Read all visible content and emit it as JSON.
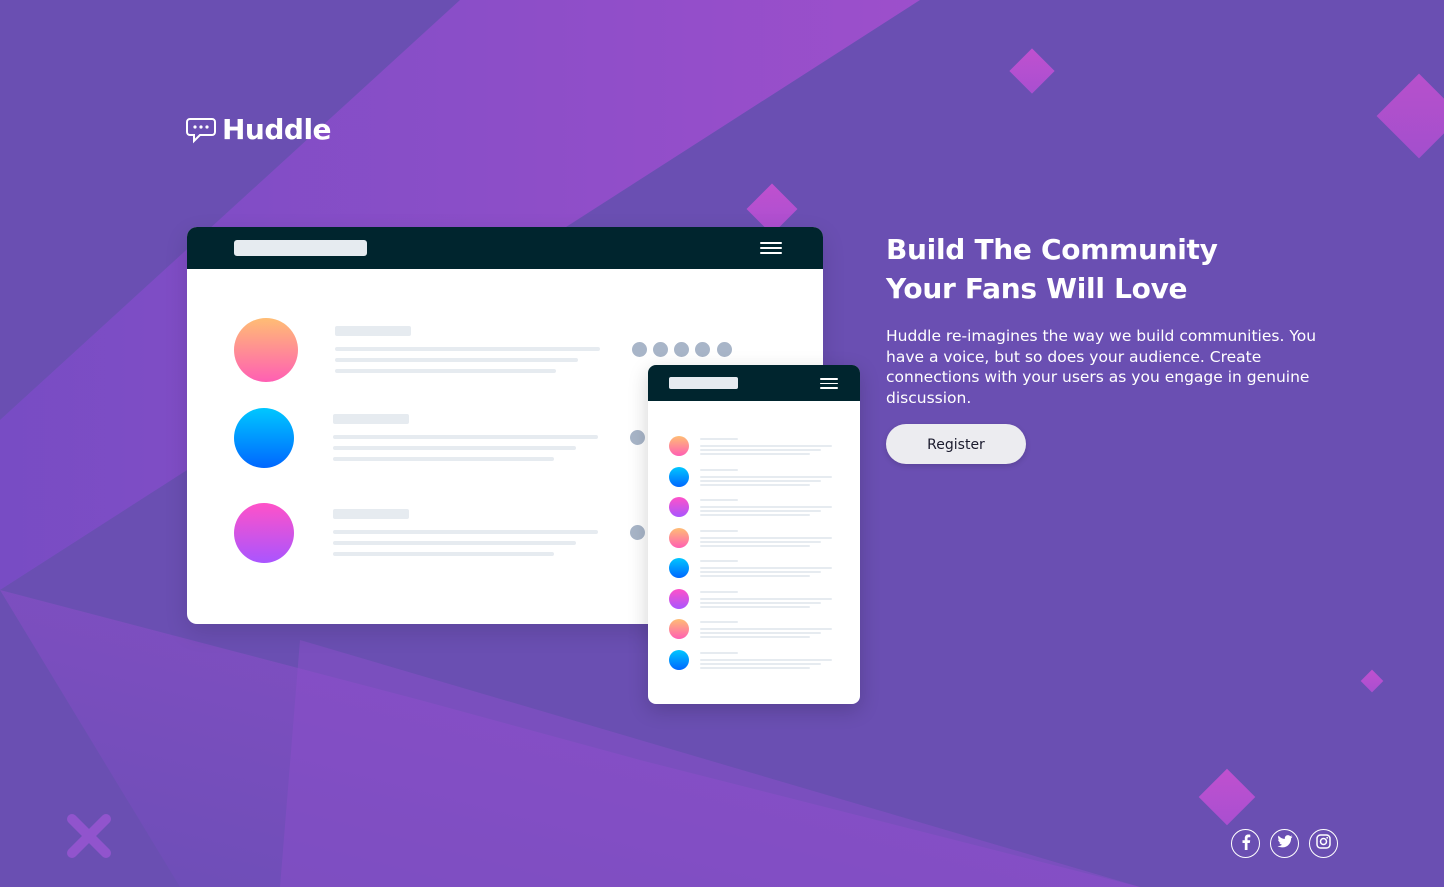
{
  "brand": {
    "name": "Huddle",
    "logo_icon": "chat-bubble-icon"
  },
  "hero": {
    "title_line1": "Build The Community",
    "title_line2": "Your Fans Will Love",
    "description": "Huddle re-imagines the way we build communities. You have a voice, but so does your audience. Create connections with your users as you engage in genuine discussion.",
    "cta_label": "Register"
  },
  "social": [
    {
      "name": "facebook",
      "icon": "facebook-icon"
    },
    {
      "name": "twitter",
      "icon": "twitter-icon"
    },
    {
      "name": "instagram",
      "icon": "instagram-icon"
    }
  ],
  "colors": {
    "background": "#6a4fb2",
    "accent_pink": "#ff52c8",
    "mockup_bar": "#00252e",
    "button_bg": "#ececf0"
  }
}
